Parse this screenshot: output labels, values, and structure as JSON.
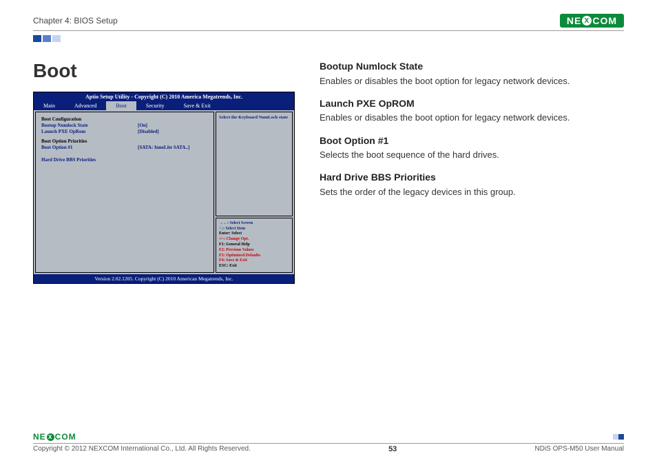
{
  "header": {
    "chapter": "Chapter 4: BIOS Setup",
    "logo_text": "NE COM",
    "logo_parts": [
      "NE",
      "X",
      "COM"
    ]
  },
  "section_title": "Boot",
  "bios": {
    "title": "Aptio Setup Utility - Copyright (C) 2010 America Megatrends, Inc.",
    "tabs": [
      "Main",
      "Advanced",
      "Boot",
      "Security",
      "Save & Exit"
    ],
    "active_tab": "Boot",
    "groups": [
      {
        "heading": "Boot Configuration",
        "rows": [
          {
            "label": "Bootup Numlock State",
            "value": "[On]"
          },
          {
            "label": "Launch PXE OpRom",
            "value": "[Disabled]"
          }
        ]
      },
      {
        "heading": "Boot Option Priorities",
        "rows": [
          {
            "label": "Boot Option #1",
            "value": "[SATA: InnoLite SATA..]"
          }
        ]
      },
      {
        "heading_only": "Hard Drive BBS Priorities"
      }
    ],
    "help": "Select the Keyboard NumLock state",
    "keys": [
      {
        "cls": "k-blue",
        "text": "→←: Select Screen"
      },
      {
        "cls": "k-blue",
        "text": "↑↓: Select Item"
      },
      {
        "cls": "k-black",
        "text": "Enter: Select"
      },
      {
        "cls": "k-red",
        "text": "+/-: Change Opt."
      },
      {
        "cls": "k-black",
        "text": "F1: General Help"
      },
      {
        "cls": "k-red",
        "text": "F2: Previous Values"
      },
      {
        "cls": "k-red",
        "text": "F3: Optimized Defaults"
      },
      {
        "cls": "k-red",
        "text": "F4: Save & Exit"
      },
      {
        "cls": "k-black",
        "text": "ESC: Exit"
      }
    ],
    "footer": "Version 2.02.1205. Copyright (C) 2010 American Megatrends, Inc."
  },
  "descriptions": [
    {
      "title": "Bootup Numlock State",
      "body": "Enables or disables the boot option for legacy network devices."
    },
    {
      "title": "Launch PXE OpROM",
      "body": "Enables or disables the boot option for legacy network devices."
    },
    {
      "title": "Boot Option #1",
      "body": "Selects the boot sequence of the hard drives."
    },
    {
      "title": "Hard Drive BBS Priorities",
      "body": "Sets the order of the legacy devices in this group."
    }
  ],
  "footer": {
    "copyright": "Copyright © 2012 NEXCOM International Co., Ltd. All Rights Reserved.",
    "page": "53",
    "manual": "NDiS OPS-M50 User Manual"
  }
}
